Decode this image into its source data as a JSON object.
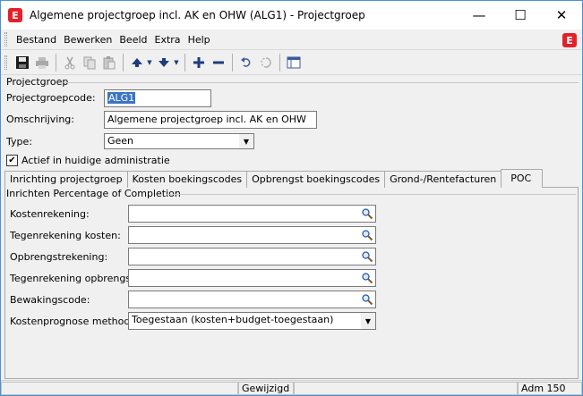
{
  "window": {
    "title": "Algemene projectgroep incl. AK en OHW (ALG1) - Projectgroep",
    "logo_letter": "E",
    "minimize": "—",
    "maximize": "☐",
    "close": "✕"
  },
  "menu": {
    "items": [
      "Bestand",
      "Bewerken",
      "Beeld",
      "Extra",
      "Help"
    ]
  },
  "toolbar": {
    "icons": [
      "save-icon",
      "print-icon",
      "cut-icon",
      "copy-icon",
      "paste-icon",
      "arrow-up-icon",
      "arrow-down-icon",
      "add-icon",
      "remove-icon",
      "undo-icon",
      "refresh-icon",
      "window-icon"
    ]
  },
  "form": {
    "section_title": "Projectgroep",
    "code_label": "Projectgroepcode:",
    "code_value": "ALG1",
    "description_label": "Omschrijving:",
    "description_value": "Algemene projectgroep incl. AK en OHW",
    "type_label": "Type:",
    "type_value": "Geen",
    "active_label": "Actief in huidige administratie",
    "active_checked": true
  },
  "tabs": [
    {
      "label": "Inrichting projectgroep",
      "active": false
    },
    {
      "label": "Kosten boekingscodes",
      "active": false
    },
    {
      "label": "Opbrengst boekingscodes",
      "active": false
    },
    {
      "label": "Grond-/Rentefacturen",
      "active": false
    },
    {
      "label": "POC",
      "active": true
    }
  ],
  "poc": {
    "group_title": "Inrichten Percentage of Completion",
    "fields": [
      {
        "label": "Kostenrekening:",
        "value": ""
      },
      {
        "label": "Tegenrekening kosten:",
        "value": ""
      },
      {
        "label": "Opbrengstrekening:",
        "value": ""
      },
      {
        "label": "Tegenrekening opbrengst:",
        "value": ""
      },
      {
        "label": "Bewakingscode:",
        "value": ""
      }
    ],
    "method_label": "Kostenprognose methode:",
    "method_value": "Toegestaan (kosten+budget-toegestaan)"
  },
  "status": {
    "state": "Gewijzigd",
    "admin": "Adm 150"
  },
  "colors": {
    "brand_red": "#e4202a",
    "selection_blue": "#3b73c6",
    "window_border": "#4a90d9"
  }
}
